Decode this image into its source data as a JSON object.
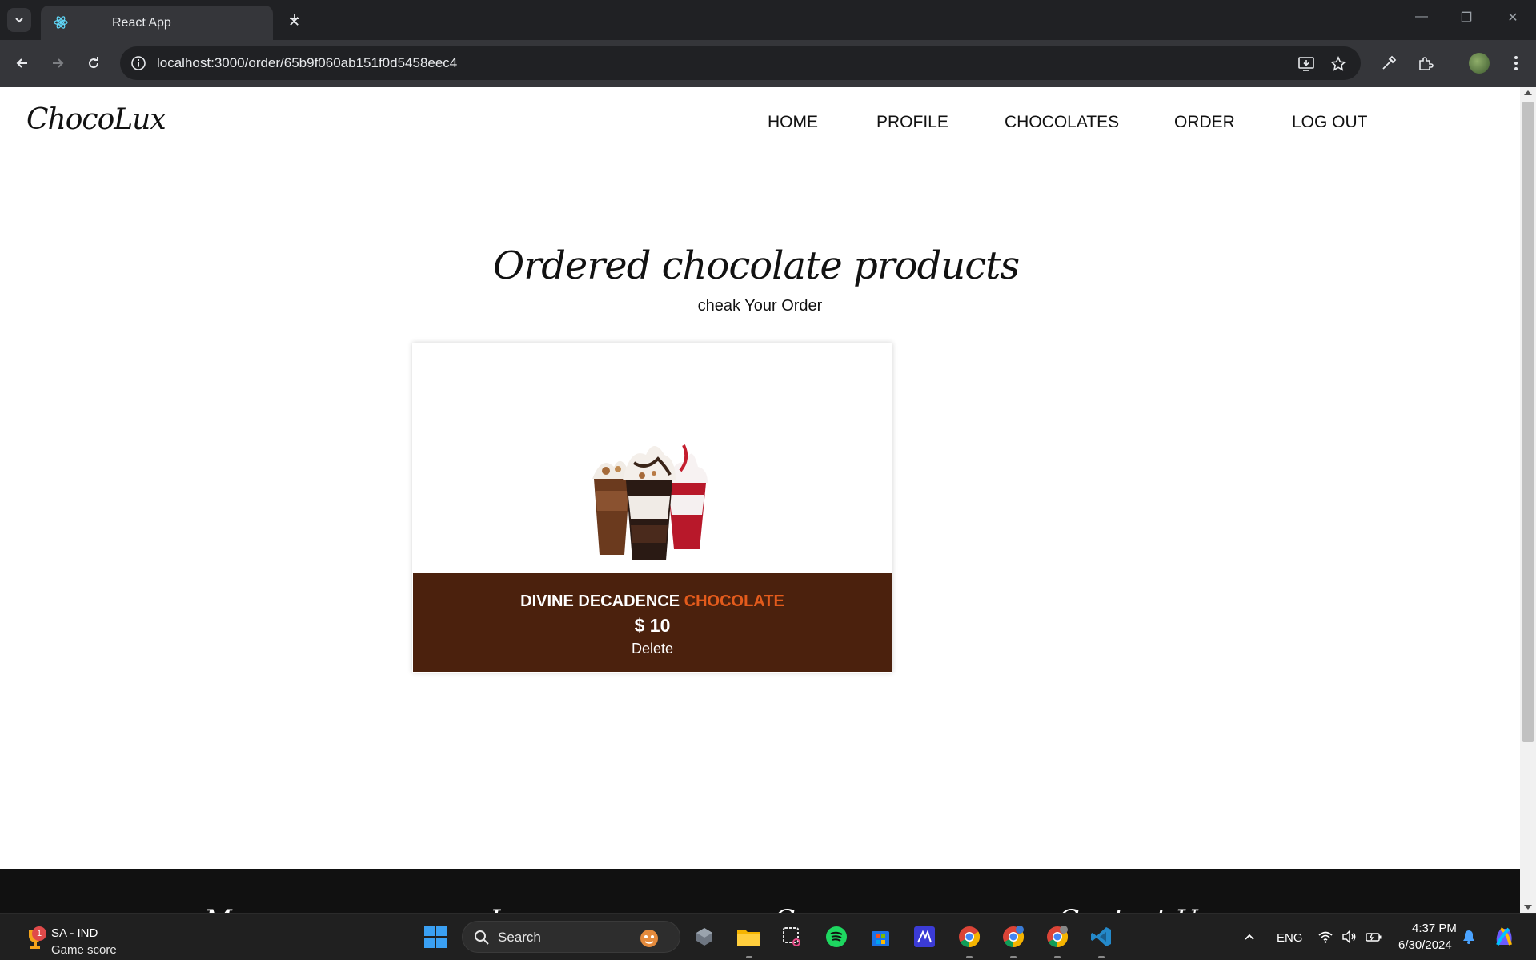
{
  "browser": {
    "tab_title": "React App",
    "url": "localhost:3000/order/65b9f060ab151f0d5458eec4"
  },
  "site": {
    "logo": "ChocoLux",
    "nav": [
      "HOME",
      "PROFILE",
      "CHOCOLATES",
      "ORDER",
      "LOG OUT"
    ]
  },
  "page": {
    "title": "Ordered chocolate products",
    "subtitle": "cheak Your Order"
  },
  "order_card": {
    "name_main": "DIVINE DECADENCE",
    "name_accent": "CHOCOLATE",
    "price": "$ 10",
    "delete_label": "Delete"
  },
  "footer": {
    "headings": [
      "M",
      "I",
      "C",
      "Contact U"
    ]
  },
  "taskbar": {
    "widget_badge": "1",
    "widget_line1": "SA - IND",
    "widget_line2": "Game score",
    "search_label": "Search",
    "language": "ENG",
    "time": "4:37 PM",
    "date": "6/30/2024"
  },
  "colors": {
    "card_info_bg": "#4b210d",
    "accent": "#e35b1c",
    "footer_bg": "#111111"
  }
}
